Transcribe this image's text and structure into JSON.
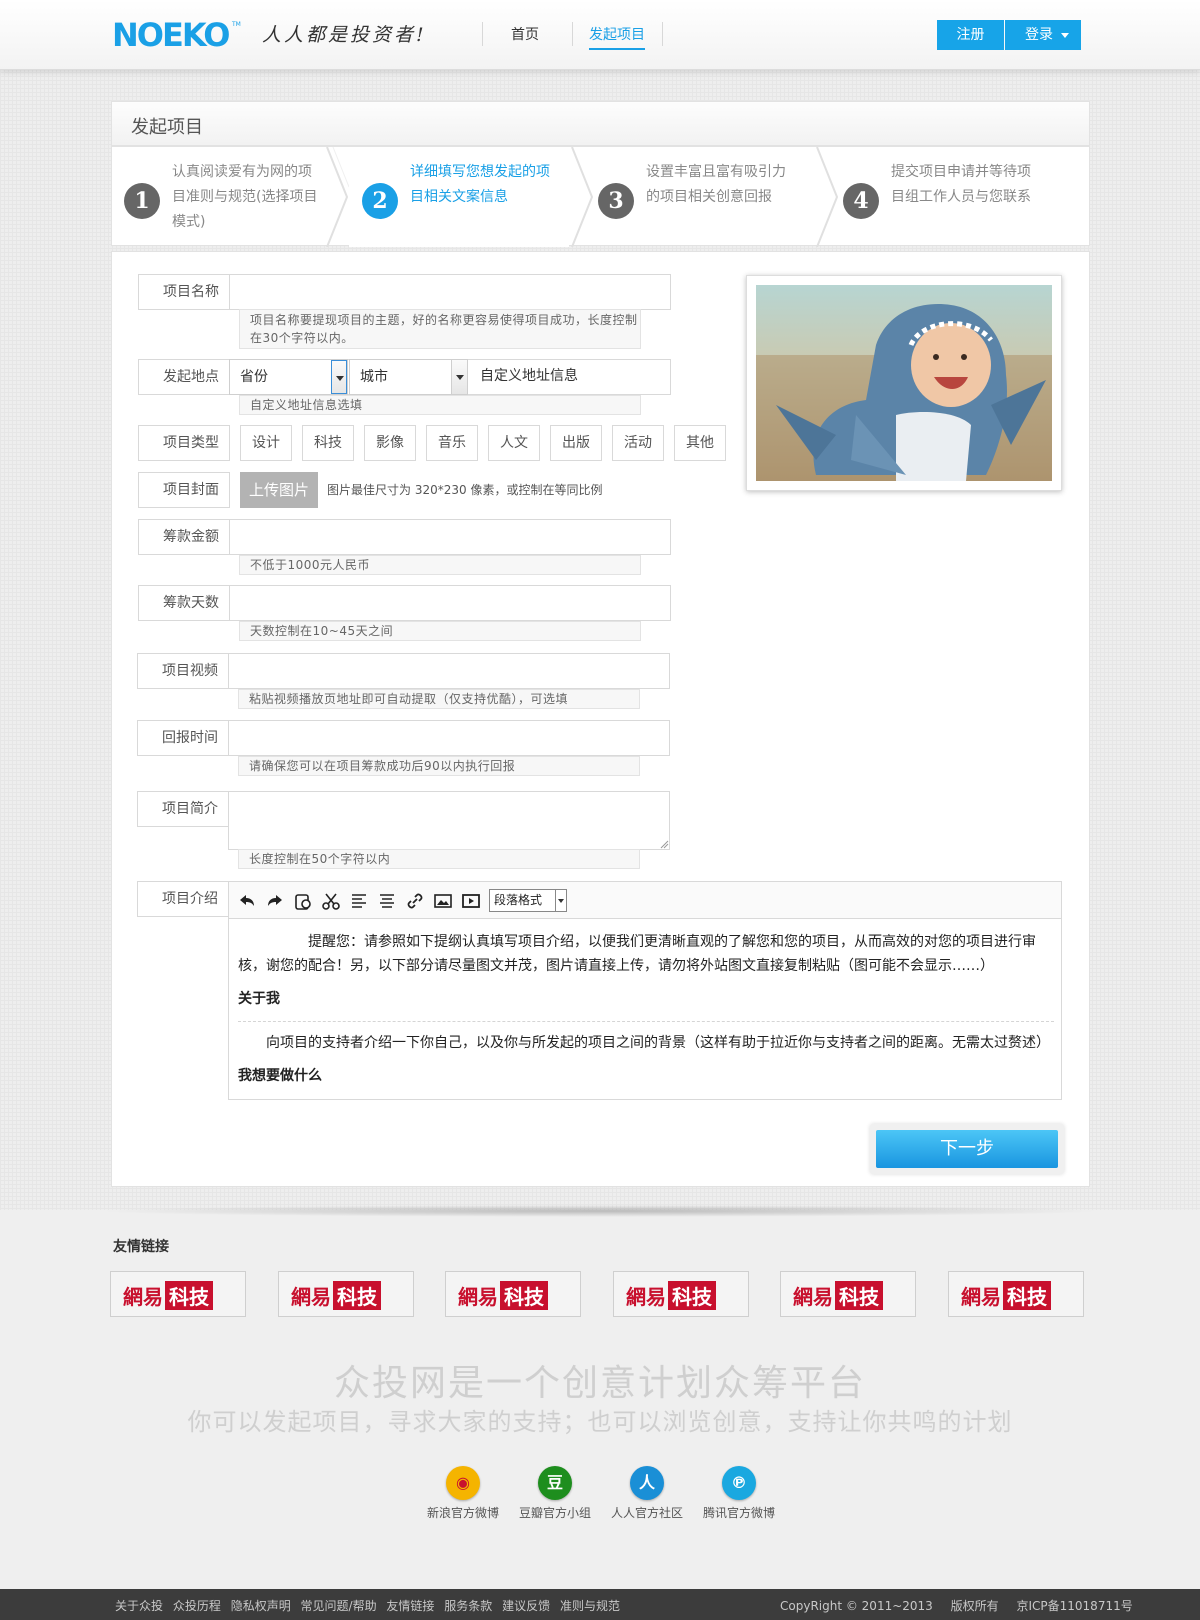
{
  "header": {
    "logo": "NOEKO",
    "logo_tm": "TM",
    "slogan": "人人都是投资者!",
    "nav": [
      {
        "label": "首页",
        "active": false
      },
      {
        "label": "发起项目",
        "active": true
      }
    ],
    "register": "注册",
    "login": "登录"
  },
  "card": {
    "title": "发起项目",
    "steps": [
      {
        "num": "1",
        "text": "认真阅读爱有为网的项目准则与规范(选择项目模式)",
        "active": false
      },
      {
        "num": "2",
        "text": "详细填写您想发起的项目相关文案信息",
        "active": true
      },
      {
        "num": "3",
        "text": "设置丰富且富有吸引力的项目相关创意回报",
        "active": false
      },
      {
        "num": "4",
        "text": "提交项目申请并等待项目组工作人员与您联系",
        "active": false
      }
    ]
  },
  "form": {
    "name": {
      "label": "项目名称",
      "value": "",
      "hint": "项目名称要提现项目的主题，好的名称更容易使得项目成功，长度控制在30个字符以内。"
    },
    "location": {
      "label": "发起地点",
      "province": "省份",
      "city": "城市",
      "custom": "自定义地址信息",
      "hint": "自定义地址信息选填"
    },
    "type": {
      "label": "项目类型",
      "options": [
        "设计",
        "科技",
        "影像",
        "音乐",
        "人文",
        "出版",
        "活动",
        "其他"
      ]
    },
    "cover": {
      "label": "项目封面",
      "button": "上传图片",
      "hint": "图片最佳尺寸为 320*230 像素，或控制在等同比例"
    },
    "amount": {
      "label": "筹款金额",
      "value": "",
      "hint": "不低于1000元人民币"
    },
    "days": {
      "label": "筹款天数",
      "value": "",
      "hint": "天数控制在10~45天之间"
    },
    "video": {
      "label": "项目视频",
      "value": "",
      "hint": "粘贴视频播放页地址即可自动提取（仅支持优酷），可选填"
    },
    "reward_time": {
      "label": "回报时间",
      "value": "",
      "hint": "请确保您可以在项目筹款成功后90以内执行回报"
    },
    "summary": {
      "label": "项目简介",
      "value": "",
      "hint": "长度控制在50个字符以内"
    },
    "intro": {
      "label": "项目介绍",
      "format": "段落格式",
      "tools": [
        "undo-icon",
        "redo-icon",
        "paste-icon",
        "cut-icon",
        "align-left-icon",
        "align-center-icon",
        "link-icon",
        "image-icon",
        "video-icon"
      ],
      "body": {
        "notice": "提醒您：请参照如下提纲认真填写项目介绍，以便我们更清晰直观的了解您和您的项目，从而高效的对您的项目进行审核，谢您的配合！另，以下部分请尽量图文并茂，图片请直接上传，请勿将外站图文直接复制粘贴（图可能不会显示……）",
        "h1": "关于我",
        "p1": "向项目的支持者介绍一下你自己，以及你与所发起的项目之间的背景（这样有助于拉近你与支持者之间的距离。无需太过赘述）",
        "h2": "我想要做什么"
      }
    },
    "next": "下一步"
  },
  "footer": {
    "links_title": "友情链接",
    "links": [
      {
        "a": "網易",
        "b": "科技"
      },
      {
        "a": "網易",
        "b": "科技"
      },
      {
        "a": "網易",
        "b": "科技"
      },
      {
        "a": "網易",
        "b": "科技"
      },
      {
        "a": "網易",
        "b": "科技"
      },
      {
        "a": "網易",
        "b": "科技"
      }
    ],
    "tagline1": "众投网是一个创意计划众筹平台",
    "tagline2": "你可以发起项目，寻求大家的支持；也可以浏览创意，支持让你共鸣的计划",
    "social": [
      {
        "label": "新浪官方微博",
        "icon": "weibo-icon",
        "glyph": "◉",
        "color": "#f5b400"
      },
      {
        "label": "豆瓣官方小组",
        "icon": "douban-icon",
        "glyph": "豆",
        "color": "#1e8e1e"
      },
      {
        "label": "人人官方社区",
        "icon": "renren-icon",
        "glyph": "人",
        "color": "#1a8fd6"
      },
      {
        "label": "腾讯官方微博",
        "icon": "tencent-weibo-icon",
        "glyph": "℗",
        "color": "#1aa8e0"
      }
    ],
    "bottom_links": [
      "关于众投",
      "众投历程",
      "隐私权声明",
      "常见问题/帮助",
      "友情链接",
      "服务条款",
      "建议反馈",
      "准则与规范"
    ],
    "copyright": "CopyRight © 2011~2013",
    "rights": "版权所有",
    "icp": "京ICP备11018711号"
  }
}
